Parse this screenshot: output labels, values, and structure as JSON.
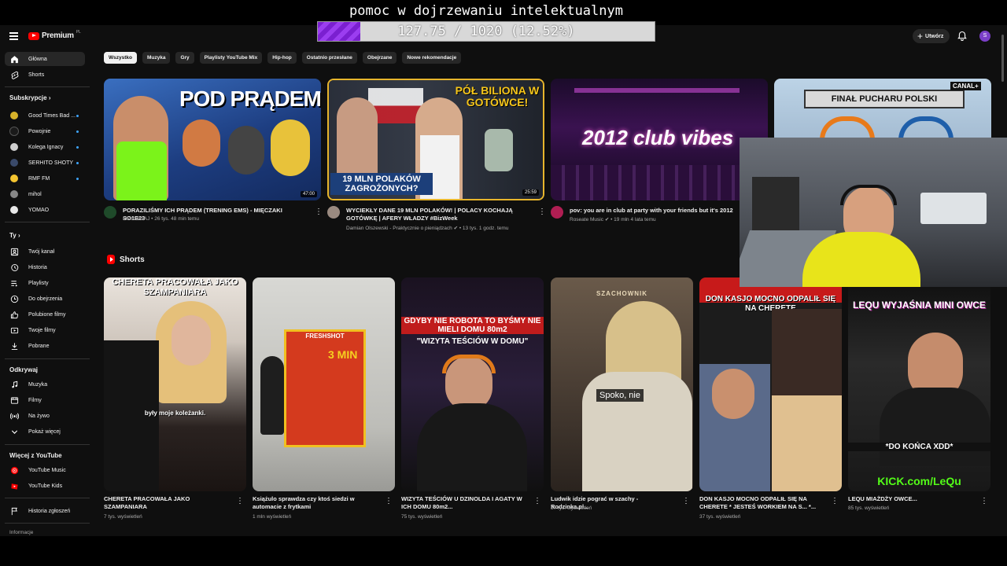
{
  "overlay": {
    "title": "pomoc w dojrzewaniu intelektualnym",
    "progress_text": "127.75 / 1020 (12.52%)",
    "progress_fraction": 0.1252
  },
  "header": {
    "logo_text": "Premium",
    "logo_country": "PL",
    "create_label": "Utwórz",
    "avatar_letter": "S"
  },
  "sidebar": {
    "main": [
      {
        "label": "Główna",
        "icon": "home-icon"
      },
      {
        "label": "Shorts",
        "icon": "shorts-icon"
      }
    ],
    "subs_heading": "Subskrypcje",
    "subs": [
      {
        "label": "Good Times Bad ...",
        "color": "#d7b22a"
      },
      {
        "label": "Powojnie",
        "color": "#1a1a1a"
      },
      {
        "label": "Kolega Ignacy",
        "color": "#cfcfcf"
      },
      {
        "label": "SERHITO SHOTY",
        "color": "#3a4a6a"
      },
      {
        "label": "RMF FM",
        "color": "#f4c430"
      },
      {
        "label": "mihol",
        "color": "#888888"
      },
      {
        "label": "YOMAO",
        "color": "#e8e8e8"
      }
    ],
    "you_heading": "Ty",
    "you": [
      {
        "label": "Twój kanał",
        "icon": "channel-icon"
      },
      {
        "label": "Historia",
        "icon": "history-icon"
      },
      {
        "label": "Playlisty",
        "icon": "playlist-icon"
      },
      {
        "label": "Do obejrzenia",
        "icon": "watch-later-icon"
      },
      {
        "label": "Polubione filmy",
        "icon": "like-icon"
      },
      {
        "label": "Twoje filmy",
        "icon": "your-videos-icon"
      },
      {
        "label": "Pobrane",
        "icon": "download-icon"
      }
    ],
    "explore_heading": "Odkrywaj",
    "explore": [
      {
        "label": "Muzyka",
        "icon": "music-icon"
      },
      {
        "label": "Filmy",
        "icon": "film-icon"
      },
      {
        "label": "Na żywo",
        "icon": "live-icon"
      },
      {
        "label": "Pokaż więcej",
        "icon": "chevron-down-icon"
      }
    ],
    "more_heading": "Więcej z YouTube",
    "more": [
      {
        "label": "YouTube Music",
        "icon": "yt-music-icon"
      },
      {
        "label": "YouTube Kids",
        "icon": "yt-kids-icon"
      }
    ],
    "report": {
      "label": "Historia zgłoszeń",
      "icon": "flag-icon"
    },
    "info": "Informacje"
  },
  "chips": [
    "Wszystko",
    "Muzyka",
    "Gry",
    "Playlisty YouTube Mix",
    "Hip-hop",
    "Ostatnio przesłane",
    "Obejrzane",
    "Nowe rekomendacje"
  ],
  "videos": [
    {
      "thumb_text": "POD PRĄDEM",
      "duration": "47:00",
      "title": "PORAZILIŚMY ICH PRĄDEM (TRENING EMS) - MIĘCZAKI SO1E23",
      "channel": "Mieczaki AJ",
      "stats": "26 tys.  48 min temu"
    },
    {
      "thumb_text": "PÓŁ BILIONA W GOTÓWCE!",
      "thumb_text2": "19 MLN POLAKÓW ZAGROŻONYCH?",
      "duration": "25:59",
      "title": "WYCIEKŁY DANE 19 MLN POLAKÓW! | POLACY KOCHAJĄ GOTÓWKĘ | AFERY WŁADZY #BizWeek",
      "channel": "Damian Olszewski - Praktycznie o pieniądzach",
      "stats": "13 tys.  1 godz. temu"
    },
    {
      "thumb_text": "2012 club vibes",
      "title": "pov: you are in club at party with your friends but it's 2012",
      "channel": "Roseate Music",
      "stats": "19 mln  4 lata temu"
    },
    {
      "thumb_text": "FINAŁ PUCHARU POLSKI",
      "thumb_badge": "CANAL+"
    }
  ],
  "shorts_heading": "Shorts",
  "shorts": [
    {
      "cap": "CHERETA PRACOWAŁA JAKO SZAMPANIARA",
      "sub": "były moje koleżanki.",
      "title": "CHERETA PRACOWAŁA JAKO SZAMPANIARA",
      "views": "7 tys. wyświetleń"
    },
    {
      "cap": "FRESHSHOT",
      "sub": "3 MIN",
      "title": "Książulo sprawdza czy ktoś siedzi w automacie z frytkami",
      "views": "1 mln wyświetleń"
    },
    {
      "cap": "GDYBY NIE ROBOTA TO BYŚMY NIE MIELI DOMU 80m2",
      "sub": "\"WIZYTA TEŚCIÓW W DOMU\"",
      "title": "WIZYTA TEŚCIÓW U DZINOLDA I AGATY W ICH DOMU 80m2...",
      "views": "75 tys. wyświetleń"
    },
    {
      "cap": "SZACHOWNIK",
      "sub": "Spoko, nie",
      "title": "Ludwik idzie pograć w szachy - Rodzinka.pl...",
      "views": "57 tys. wyświetleń"
    },
    {
      "cap": "DON KASJO MOCNO ODPALIŁ SIĘ NA CHERETE",
      "title": "DON KASJO MOCNO ODPALIŁ SIĘ NA CHERETE * JESTEŚ WORKIEM NA S... *...",
      "views": "37 tys. wyświetleń"
    },
    {
      "cap": "LEQU WYJAŚNIA MINI OWCE",
      "sub": "*DO KOŃCA XDD*",
      "sub2": "KICK.com/LeQu",
      "title": "LEQU MIAŻDŻY OWCE...",
      "views": "85 tys. wyświetleń"
    }
  ]
}
